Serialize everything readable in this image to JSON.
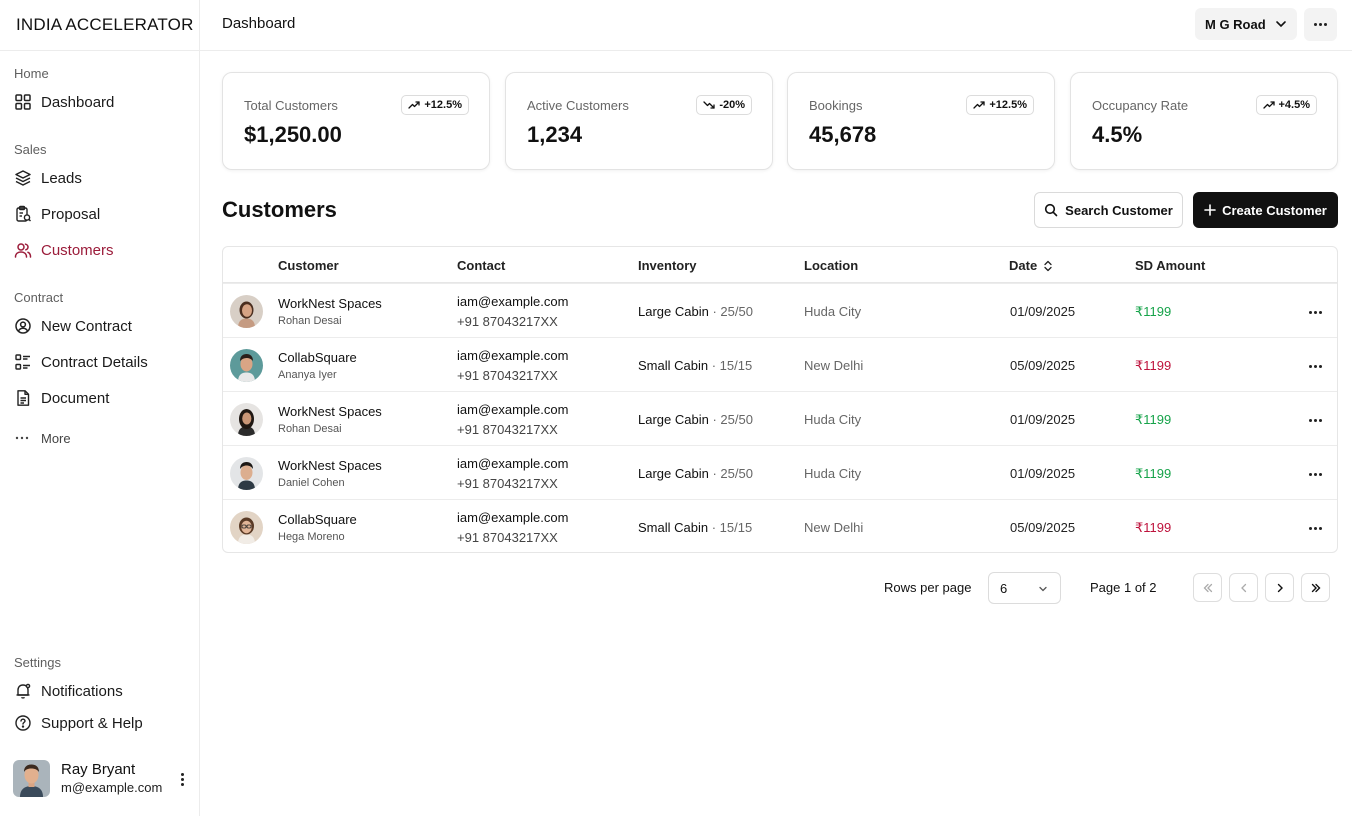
{
  "brand": "INDIA ACCELERATOR",
  "header": {
    "title": "Dashboard",
    "location": "M G Road"
  },
  "sidebar": {
    "sections": [
      {
        "label": "Home",
        "items": [
          {
            "label": "Dashboard",
            "icon": "grid-icon"
          }
        ]
      },
      {
        "label": "Sales",
        "items": [
          {
            "label": "Leads",
            "icon": "layers-icon"
          },
          {
            "label": "Proposal",
            "icon": "clipboard-icon"
          },
          {
            "label": "Customers",
            "icon": "users-icon",
            "active": true
          }
        ]
      },
      {
        "label": "Contract",
        "items": [
          {
            "label": "New Contract",
            "icon": "user-circle-icon"
          },
          {
            "label": "Contract Details",
            "icon": "list-icon"
          },
          {
            "label": "Document",
            "icon": "file-icon"
          }
        ]
      }
    ],
    "more_label": "More",
    "settings": {
      "label": "Settings",
      "items": [
        {
          "label": "Notifications",
          "icon": "bell-icon"
        },
        {
          "label": "Support & Help",
          "icon": "help-circle-icon"
        }
      ]
    },
    "user": {
      "name": "Ray Bryant",
      "email": "m@example.com"
    }
  },
  "stats": [
    {
      "label": "Total Customers",
      "value": "$1,250.00",
      "change": "+12.5%",
      "trend": "up"
    },
    {
      "label": "Active Customers",
      "value": "1,234",
      "change": "-20%",
      "trend": "down"
    },
    {
      "label": "Bookings",
      "value": "45,678",
      "change": "+12.5%",
      "trend": "up"
    },
    {
      "label": "Occupancy Rate",
      "value": "4.5%",
      "change": "+4.5%",
      "trend": "up"
    }
  ],
  "customers": {
    "title": "Customers",
    "search_label": "Search Customer",
    "create_label": "Create Customer",
    "columns": [
      "Customer",
      "Contact",
      "Inventory",
      "Location",
      "Date",
      "SD Amount"
    ],
    "rows": [
      {
        "company": "WorkNest Spaces",
        "person": "Rohan Desai",
        "email": "iam@example.com",
        "phone": "+91 87043217XX",
        "inventory": "Large Cabin",
        "capacity": "· 25/50",
        "location": "Huda City",
        "date": "01/09/2025",
        "amount": "₹1199",
        "amount_status": "paid"
      },
      {
        "company": "CollabSquare",
        "person": "Ananya Iyer",
        "email": "iam@example.com",
        "phone": "+91 87043217XX",
        "inventory": "Small Cabin",
        "capacity": "· 15/15",
        "location": "New Delhi",
        "date": "05/09/2025",
        "amount": "₹1199",
        "amount_status": "due"
      },
      {
        "company": "WorkNest Spaces",
        "person": "Rohan Desai",
        "email": "iam@example.com",
        "phone": "+91 87043217XX",
        "inventory": "Large Cabin",
        "capacity": "· 25/50",
        "location": "Huda City",
        "date": "01/09/2025",
        "amount": "₹1199",
        "amount_status": "paid"
      },
      {
        "company": "WorkNest Spaces",
        "person": "Daniel Cohen",
        "email": "iam@example.com",
        "phone": "+91 87043217XX",
        "inventory": "Large Cabin",
        "capacity": "· 25/50",
        "location": "Huda City",
        "date": "01/09/2025",
        "amount": "₹1199",
        "amount_status": "paid"
      },
      {
        "company": "CollabSquare",
        "person": "Hega Moreno",
        "email": "iam@example.com",
        "phone": "+91 87043217XX",
        "inventory": "Small Cabin",
        "capacity": "· 15/15",
        "location": "New Delhi",
        "date": "05/09/2025",
        "amount": "₹1199",
        "amount_status": "due"
      }
    ]
  },
  "pagination": {
    "rows_label": "Rows per page",
    "rows_value": "6",
    "page_label": "Page 1 of 2"
  },
  "colors": {
    "accent": "#9b1c3a",
    "paid": "#16a34a",
    "due": "#be123c",
    "primary_button": "#111111"
  }
}
